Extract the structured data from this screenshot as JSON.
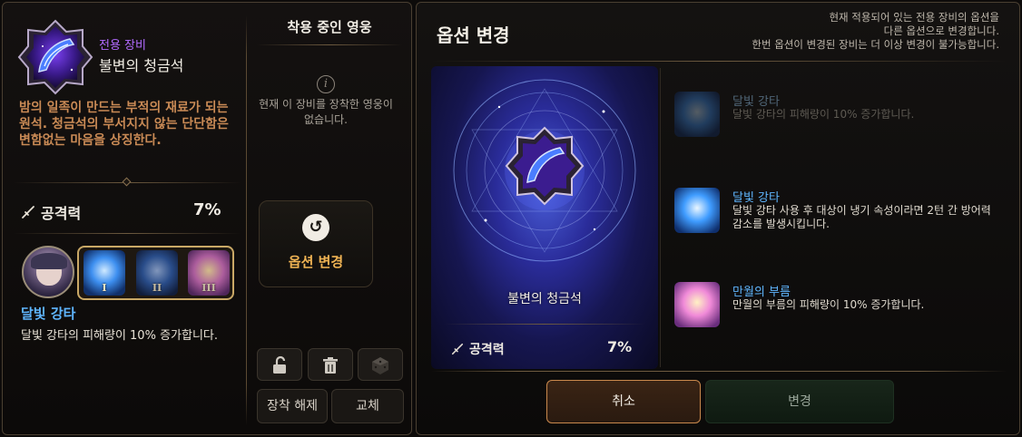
{
  "item": {
    "type_label": "전용 장비",
    "name": "불변의 청금석",
    "lore": "밤의 일족이 만드는 부적의 재료가 되는 원석. 청금석의 부서지지 않는 단단함은 변함없는 마음을 상징한다.",
    "stat_name": "공격력",
    "stat_value": "7%"
  },
  "hero_skill": {
    "roman": [
      "I",
      "II",
      "III"
    ],
    "title": "달빛 강타",
    "desc": "달빛 강타의 피해량이 10% 증가합니다."
  },
  "equipped": {
    "title": "착용 중인 영웅",
    "message": "현재 이 장비를 장착한 영웅이 없습니다.",
    "option_button": "옵션 변경",
    "unequip": "장착 해제",
    "swap": "교체"
  },
  "option_change": {
    "title": "옵션 변경",
    "note_line1": "현재 적용되어 있는 전용 장비의 옵션을",
    "note_line2": "다른 옵션으로 변경합니다.",
    "note_line3": "한번 옵션이 변경된 장비는 더 이상 변경이 불가능합니다.",
    "preview_name": "불변의 청금석",
    "preview_stat_name": "공격력",
    "preview_stat_value": "7%",
    "options": [
      {
        "name": "달빛 강타",
        "desc": "달빛 강타의 피해량이 10% 증가합니다.",
        "state": "disabled"
      },
      {
        "name": "달빛 강타",
        "desc": "달빛 강타 사용 후 대상이 냉기 속성이라면 2턴 간 방어력 감소를 발생시킵니다.",
        "state": "enabled"
      },
      {
        "name": "만월의 부름",
        "desc": "만월의 부름의 피해량이 10% 증가합니다.",
        "state": "enabled"
      }
    ],
    "cancel": "취소",
    "confirm": "변경"
  },
  "colors": {
    "accent_gold": "#c9a866",
    "skill_blue": "#5fb6ff",
    "lore_orange": "#c98a55",
    "item_type_purple": "#b26bff",
    "option_btn_orange": "#f0b454"
  }
}
